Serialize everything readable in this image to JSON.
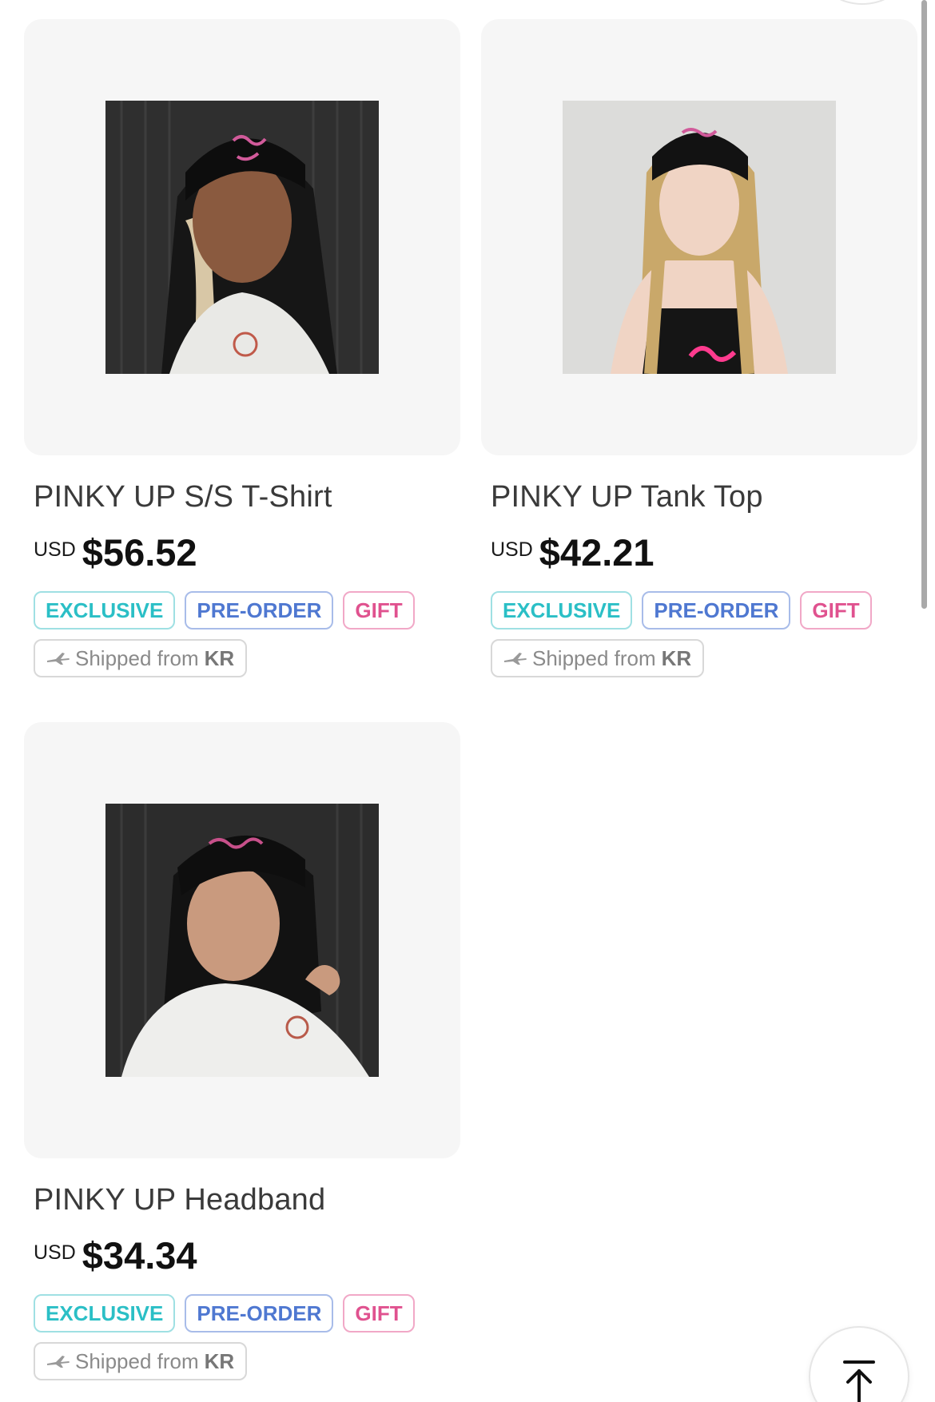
{
  "products": [
    {
      "name": "PINKY UP S/S T-Shirt",
      "currency": "USD",
      "price": "$56.52",
      "image_icon": "model-headband-photo",
      "tags": [
        "EXCLUSIVE",
        "PRE-ORDER",
        "GIFT"
      ],
      "ship_text": "Shipped from",
      "ship_origin": "KR"
    },
    {
      "name": "PINKY UP Tank Top",
      "currency": "USD",
      "price": "$42.21",
      "image_icon": "model-tank-top-photo",
      "tags": [
        "EXCLUSIVE",
        "PRE-ORDER",
        "GIFT"
      ],
      "ship_text": "Shipped from",
      "ship_origin": "KR"
    },
    {
      "name": "PINKY UP Headband",
      "currency": "USD",
      "price": "$34.34",
      "image_icon": "model-headband-photo",
      "tags": [
        "EXCLUSIVE",
        "PRE-ORDER",
        "GIFT"
      ],
      "ship_text": "Shipped from",
      "ship_origin": "KR"
    }
  ],
  "colors": {
    "exclusive": "#2bbfc6",
    "preorder": "#4f78d1",
    "gift": "#e0528f",
    "card_bg": "#f6f6f6"
  },
  "scroll_top_icon": "arrow-up-to-top-icon"
}
